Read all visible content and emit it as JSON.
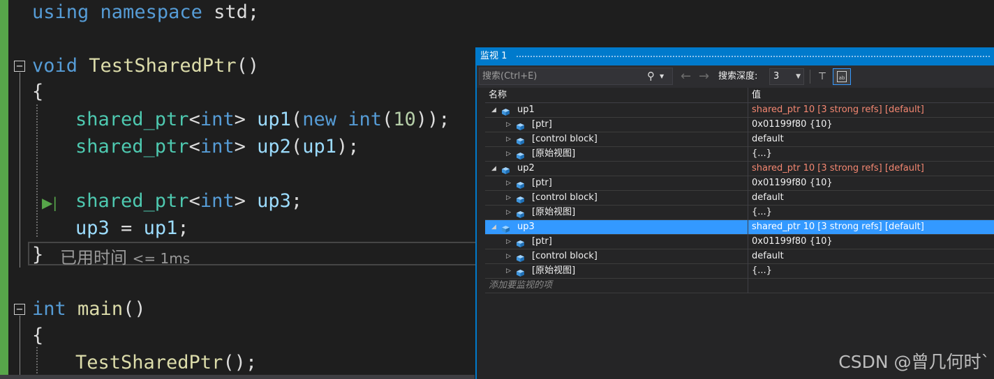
{
  "editor": {
    "lines": {
      "l_using": {
        "kw": "using",
        "ns": "namespace",
        "rest": " std;"
      },
      "l_func": {
        "kw": "void",
        "name": "TestSharedPtr",
        "parens": "()"
      },
      "l_open1": "{",
      "l_up1": {
        "ty": "shared_ptr",
        "lt": "<",
        "int": "int",
        "gt": ">",
        "var": "up1",
        "p1": "(",
        "new": "new",
        "int2": "int",
        "p2": "(",
        "num": "10",
        "end": "));"
      },
      "l_up2": {
        "ty": "shared_ptr",
        "lt": "<",
        "int": "int",
        "gt": ">",
        "var": "up2",
        "p1": "(",
        "arg": "up1",
        "end": ");"
      },
      "l_up3": {
        "ty": "shared_ptr",
        "lt": "<",
        "int": "int",
        "gt": ">",
        "var": "up3",
        "end": ";"
      },
      "l_assign": {
        "lhs": "up3",
        "op": " = ",
        "rhs": "up1",
        "end": ";"
      },
      "l_close1": "}",
      "l_main": {
        "kw": "int",
        "name": "main",
        "parens": "()"
      },
      "l_open2": "{",
      "l_call": {
        "name": "TestSharedPtr",
        "end": "();"
      }
    },
    "fold_glyph": "−",
    "step_glyph": "▶|",
    "perf_tip": {
      "label": "已用时间",
      "value": "<= 1ms"
    }
  },
  "watch": {
    "title": "监视 1",
    "search_placeholder": "搜索(Ctrl+E)",
    "depth_label": "搜索深度:",
    "depth_value": "3",
    "columns": {
      "name": "名称",
      "value": "值"
    },
    "rows": [
      {
        "name": "up1",
        "value": "shared_ptr 10 [3 strong refs] [default]",
        "level": 0,
        "expanded": true,
        "changed": true
      },
      {
        "name": "[ptr]",
        "value": "0x01199f80 {10}",
        "level": 1
      },
      {
        "name": "[control block]",
        "value": "default",
        "level": 1
      },
      {
        "name": "[原始视图]",
        "value": "{...}",
        "level": 1
      },
      {
        "name": "up2",
        "value": "shared_ptr 10 [3 strong refs] [default]",
        "level": 0,
        "expanded": true,
        "changed": true
      },
      {
        "name": "[ptr]",
        "value": "0x01199f80 {10}",
        "level": 1
      },
      {
        "name": "[control block]",
        "value": "default",
        "level": 1
      },
      {
        "name": "[原始视图]",
        "value": "{...}",
        "level": 1
      },
      {
        "name": "up3",
        "value": "shared_ptr 10 [3 strong refs] [default]",
        "level": 0,
        "expanded": true,
        "selected": true
      },
      {
        "name": "[ptr]",
        "value": "0x01199f80 {10}",
        "level": 1
      },
      {
        "name": "[control block]",
        "value": "default",
        "level": 1
      },
      {
        "name": "[原始视图]",
        "value": "{...}",
        "level": 1
      }
    ],
    "add_item_placeholder": "添加要监视的项"
  },
  "watermark": "CSDN @曾几何时`",
  "colors": {
    "accent": "#007acc",
    "selection": "#3399ff",
    "changed_value": "#f48771",
    "change_bar": "#57a64a"
  }
}
